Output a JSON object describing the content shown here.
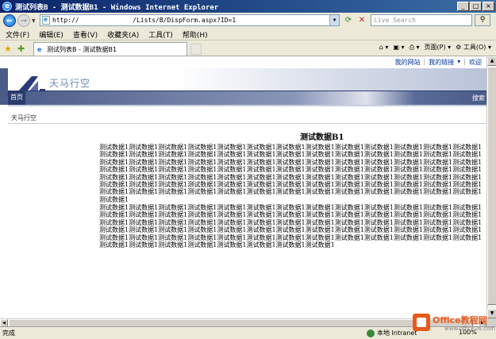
{
  "window": {
    "title": "测试列表B - 测试数据B1 - Windows Internet Explorer"
  },
  "address_bar": {
    "url": "http://              /Lists/B/DispForm.aspx?ID=1",
    "search_placeholder": "Live Search"
  },
  "menu": {
    "items": [
      "文件(F)",
      "编辑(E)",
      "查看(V)",
      "收藏夹(A)",
      "工具(T)",
      "帮助(H)"
    ]
  },
  "tab": {
    "label": "测试列表B - 测试数据B1"
  },
  "command_bar": {
    "page_label": "页面(P)",
    "tools_label": "工具(O)"
  },
  "sharepoint": {
    "top_links": [
      "我的网站",
      "我的链接",
      "欢迎"
    ],
    "site_name": "天马行空",
    "home_tab": "首页",
    "search_label": "搜索",
    "breadcrumb": "天马行空",
    "heading": "测试数据B1",
    "paragraph1": "测试数据1测试数据1测试数据1测试数据1测试数据1测试数据1测试数据1测试数据1测试数据1测试数据1测试数据1测试数据1测试数据1测试数据1测试数据1测试数据1测试数据1测试数据1测试数据1测试数据1测试数据1测试数据1测试数据1测试数据1测试数据1测试数据1测试数据1测试数据1测试数据1测试数据1测试数据1测试数据1测试数据1测试数据1测试数据1测试数据1测试数据1测试数据1测试数据1测试数据1测试数据1测试数据1测试数据1测试数据1测试数据1测试数据1测试数据1测试数据1测试数据1测试数据1测试数据1测试数据1测试数据1测试数据1测试数据1测试数据1测试数据1测试数据1测试数据1测试数据1测试数据1测试数据1测试数据1测试数据1测试数据1测试数据1测试数据1测试数据1测试数据1测试数据1测试数据1测试数据1测试数据1测试数据1测试数据1测试数据1测试数据1测试数据1测试数据1测试数据1测试数据1测试数据1测试数据1测试数据1测试数据1测试数据1测试数据1测试数据1测试数据1测试数据1测试数据1测试数据1",
    "paragraph2": "测试数据1测试数据1测试数据1测试数据1测试数据1测试数据1测试数据1测试数据1测试数据1测试数据1测试数据1测试数据1测试数据1测试数据1测试数据1测试数据1测试数据1测试数据1测试数据1测试数据1测试数据1测试数据1测试数据1测试数据1测试数据1测试数据1测试数据1测试数据1测试数据1测试数据1测试数据1测试数据1测试数据1测试数据1测试数据1测试数据1测试数据1测试数据1测试数据1测试数据1测试数据1测试数据1测试数据1测试数据1测试数据1测试数据1测试数据1测试数据1测试数据1测试数据1测试数据1测试数据1测试数据1测试数据1测试数据1测试数据1测试数据1测试数据1测试数据1测试数据1测试数据1测试数据1测试数据1测试数据1测试数据1测试数据1测试数据1测试数据1测试数据1测试数据1测试数据1测试数据1测试数据1"
  },
  "status_bar": {
    "status": "完成",
    "zone": "本地 Intranet",
    "zoom": "100%"
  },
  "watermark": {
    "text": "Office教程网",
    "sub": "www.office26.com"
  },
  "colors": {
    "titlebar": "#0a246a",
    "sp_nav": "#4b5b88",
    "link": "#003399"
  }
}
